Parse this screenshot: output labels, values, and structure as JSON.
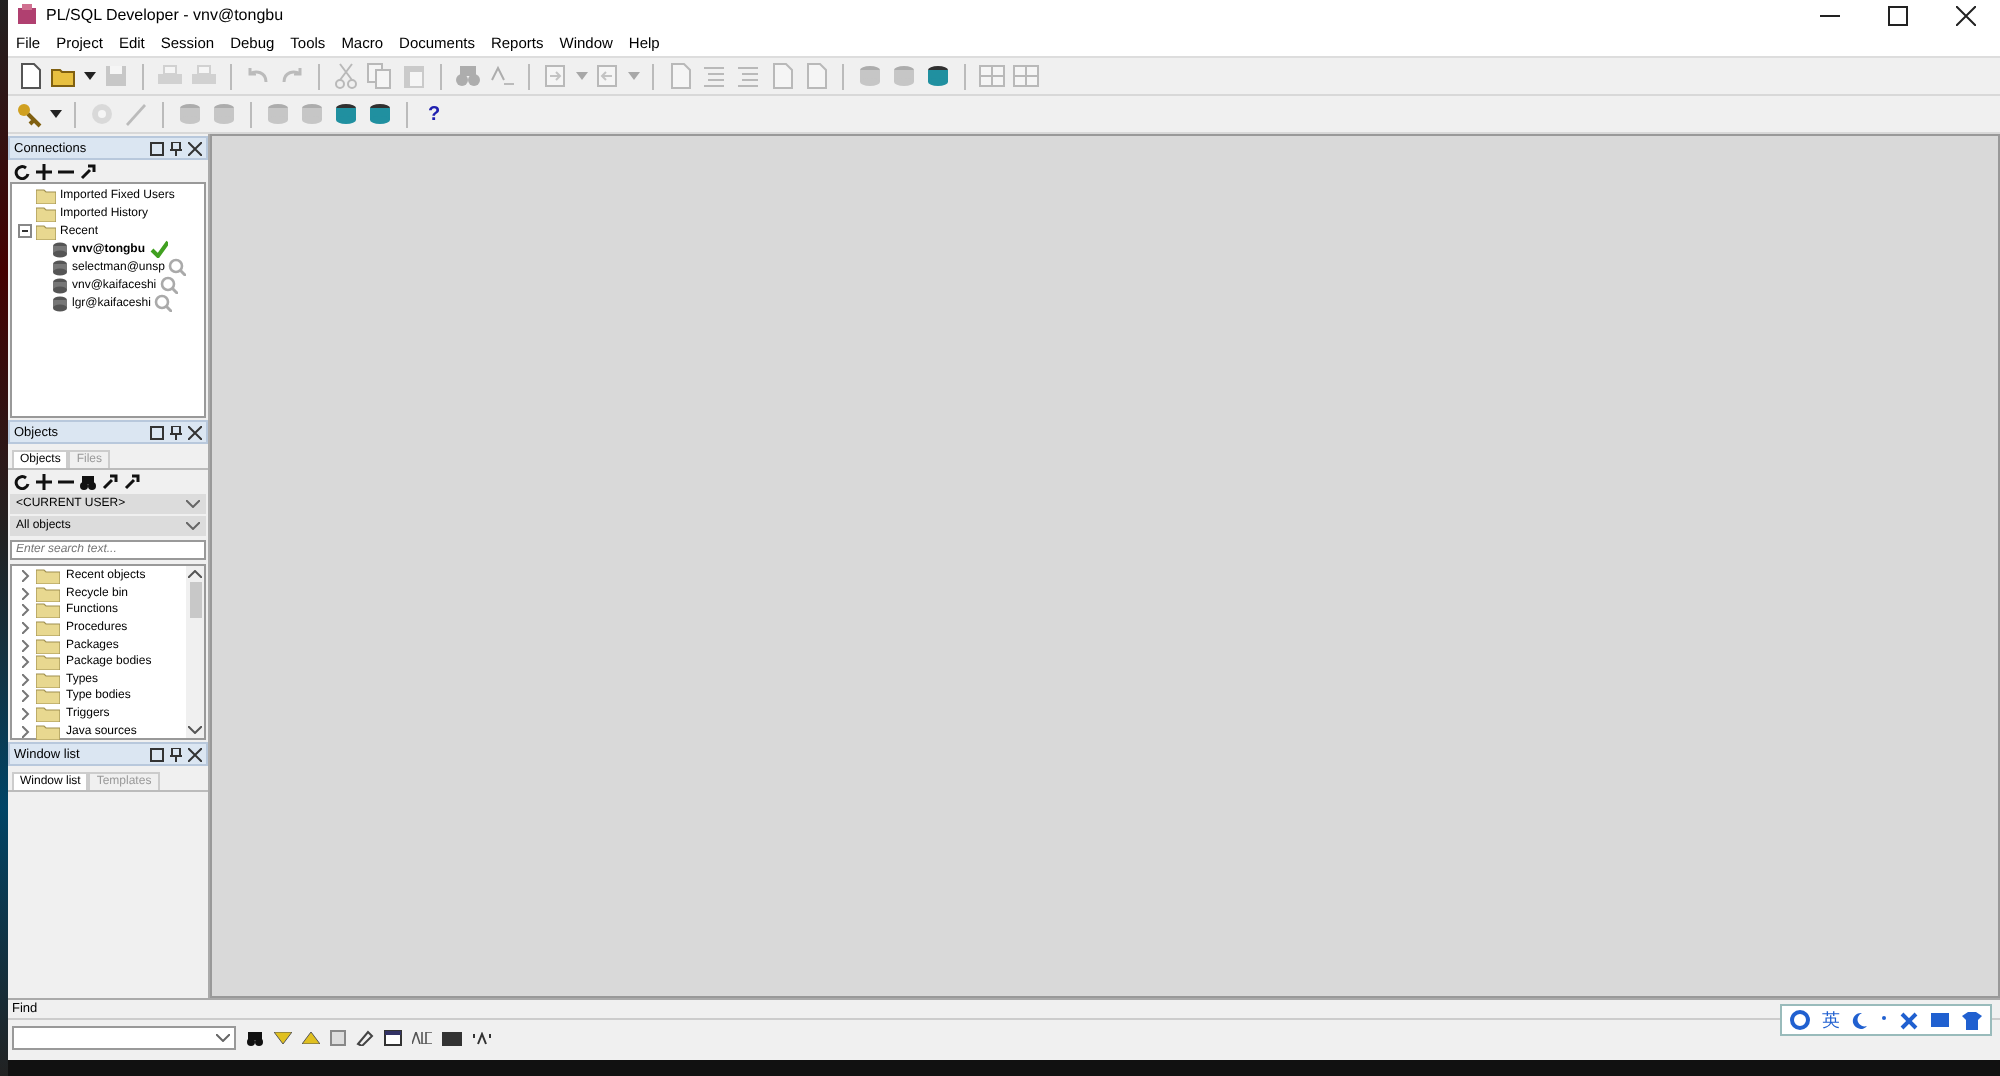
{
  "window": {
    "title": "PL/SQL Developer - vnv@tongbu"
  },
  "menu": [
    "File",
    "Project",
    "Edit",
    "Session",
    "Debug",
    "Tools",
    "Macro",
    "Documents",
    "Reports",
    "Window",
    "Help"
  ],
  "toolbar_1": [
    [
      {
        "kind": "new",
        "disabled": false
      },
      {
        "kind": "open",
        "disabled": false,
        "dropdown": true
      },
      {
        "kind": "save",
        "disabled": true
      }
    ],
    [
      {
        "kind": "print",
        "disabled": true
      },
      {
        "kind": "print",
        "disabled": true
      }
    ],
    [
      {
        "kind": "undo",
        "disabled": true
      },
      {
        "kind": "redo",
        "disabled": true
      }
    ],
    [
      {
        "kind": "cut",
        "disabled": true
      },
      {
        "kind": "copy",
        "disabled": true
      },
      {
        "kind": "paste",
        "disabled": true
      }
    ],
    [
      {
        "kind": "find",
        "disabled": true
      },
      {
        "kind": "replace",
        "disabled": true
      }
    ],
    [
      {
        "kind": "indent",
        "disabled": true,
        "dropdown": true
      },
      {
        "kind": "outdent",
        "disabled": true,
        "dropdown": true
      }
    ],
    [
      {
        "kind": "page",
        "disabled": true
      },
      {
        "kind": "lines",
        "disabled": true
      },
      {
        "kind": "lines",
        "disabled": true
      },
      {
        "kind": "page",
        "disabled": true
      },
      {
        "kind": "page",
        "disabled": true
      }
    ],
    [
      {
        "kind": "database",
        "disabled": true
      },
      {
        "kind": "database",
        "disabled": true
      },
      {
        "kind": "database",
        "disabled": false
      }
    ],
    [
      {
        "kind": "grid",
        "disabled": true
      },
      {
        "kind": "grid",
        "disabled": true
      }
    ]
  ],
  "toolbar_2": [
    [
      {
        "kind": "key",
        "disabled": false,
        "dropdown": true
      }
    ],
    [
      {
        "kind": "gear",
        "disabled": true
      },
      {
        "kind": "pen",
        "disabled": true
      }
    ],
    [
      {
        "kind": "database",
        "disabled": true
      },
      {
        "kind": "database",
        "disabled": true
      }
    ],
    [
      {
        "kind": "database",
        "disabled": true
      },
      {
        "kind": "database",
        "disabled": true
      },
      {
        "kind": "database",
        "disabled": false
      },
      {
        "kind": "database",
        "disabled": false
      }
    ],
    [
      {
        "kind": "help",
        "disabled": false,
        "glyph": "?"
      }
    ]
  ],
  "connections": {
    "title": "Connections",
    "tree": [
      {
        "label": "Imported Fixed Users"
      },
      {
        "label": "Imported History"
      },
      {
        "label": "Recent",
        "expanded": true,
        "children": [
          {
            "label": "vnv@tongbu",
            "active": true
          },
          {
            "label": "selectman@unsp",
            "active": false
          },
          {
            "label": "vnv@kaifaceshi",
            "active": false
          },
          {
            "label": "lgr@kaifaceshi",
            "active": false
          }
        ]
      }
    ]
  },
  "objects": {
    "title": "Objects",
    "tabs": [
      {
        "label": "Objects",
        "selected": true
      },
      {
        "label": "Files",
        "selected": false
      }
    ],
    "user_select": "<CURRENT USER>",
    "filter_select": "All objects",
    "search": {
      "placeholder": "Enter search text..."
    },
    "items": [
      "Recent objects",
      "Recycle bin",
      "Functions",
      "Procedures",
      "Packages",
      "Package bodies",
      "Types",
      "Type bodies",
      "Triggers",
      "Java sources"
    ]
  },
  "window_list": {
    "title": "Window list",
    "tabs": [
      {
        "label": "Window list",
        "selected": true
      },
      {
        "label": "Templates",
        "selected": false
      }
    ]
  },
  "find_bar": {
    "label": "Find"
  },
  "ime_toolbar": {
    "mode": "英"
  }
}
